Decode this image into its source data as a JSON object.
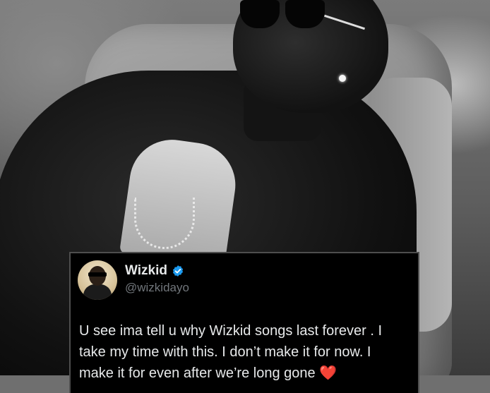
{
  "tweet": {
    "author_name": "Wizkid",
    "handle": "@wizkidayo",
    "verified_icon": "verified-badge-icon",
    "text_lines": [
      "U see ima tell u why Wizkid songs last forever . I",
      "take my time with this. I don’t make it for now. I",
      "make it for even after we’re long gone "
    ],
    "heart_emoji": "❤️"
  },
  "colors": {
    "card_background": "#000000",
    "card_border": "#4e4e4e",
    "text_primary": "#e7e9ea",
    "text_secondary": "#71767b",
    "verified_blue": "#1d9bf0"
  },
  "icons": [
    "verified-badge-icon",
    "heart-emoji-icon"
  ]
}
